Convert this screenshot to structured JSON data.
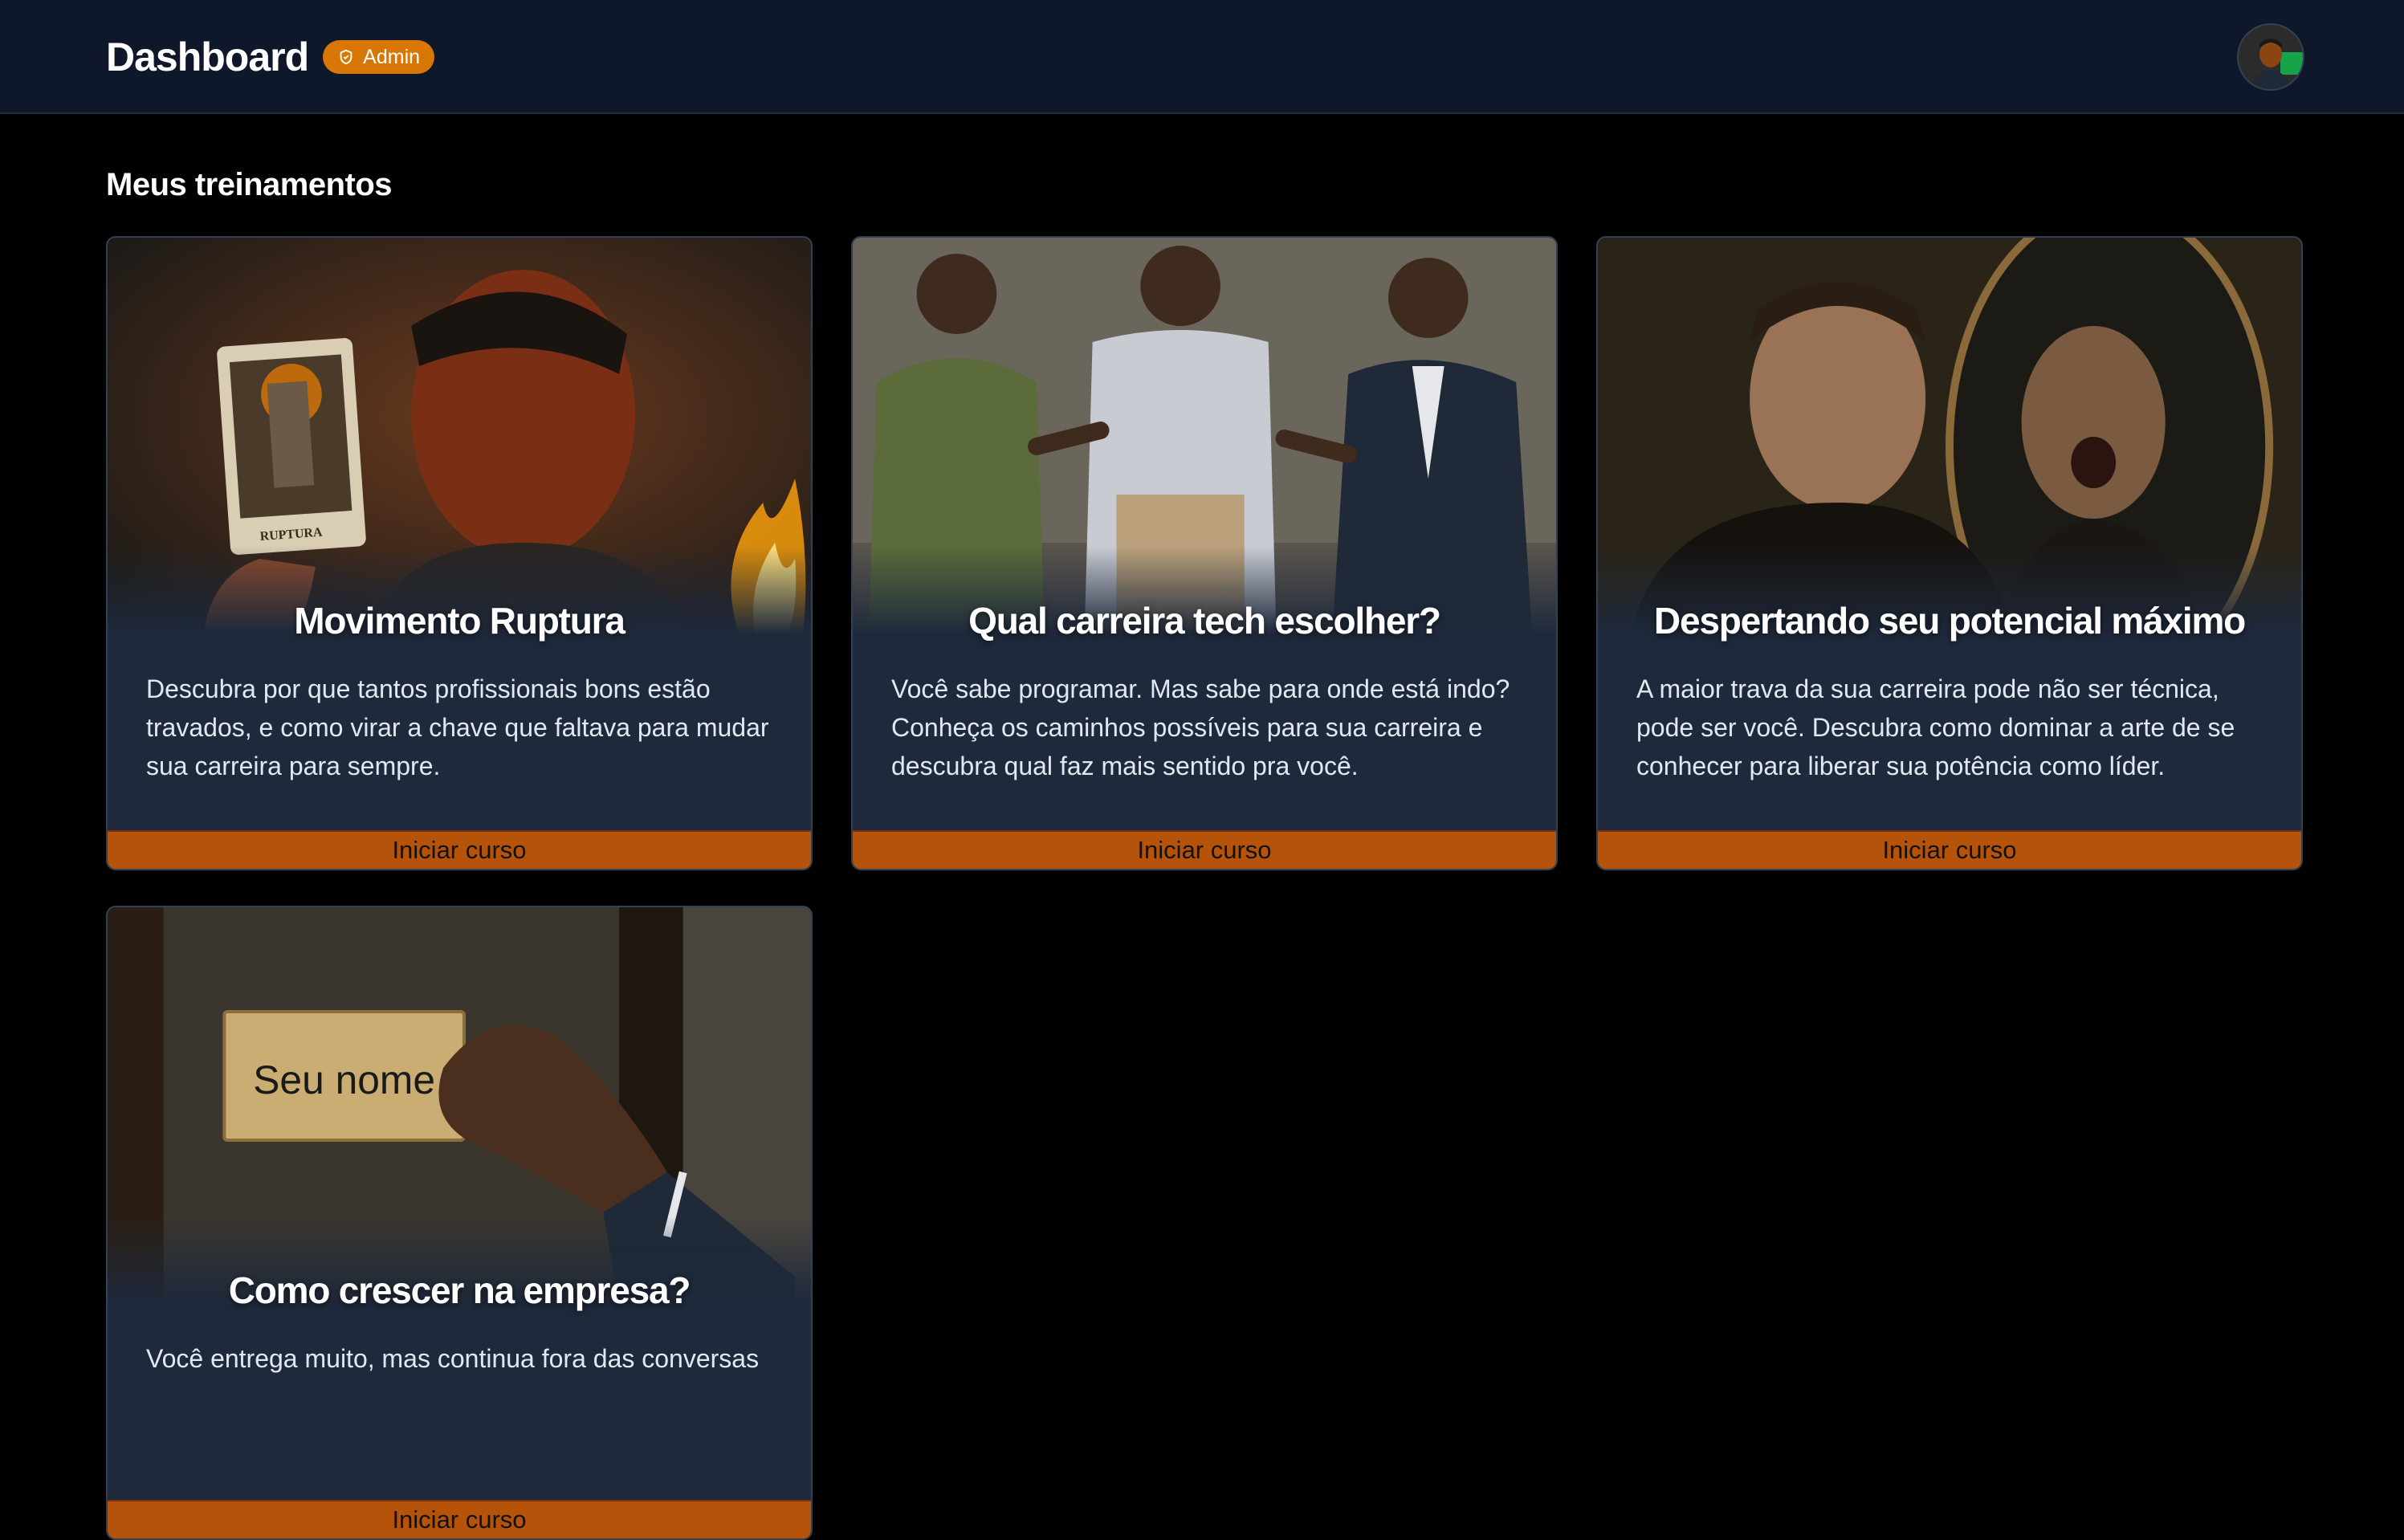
{
  "header": {
    "title": "Dashboard",
    "badge_label": "Admin",
    "badge_icon": "shield-check-icon",
    "avatar": "user-avatar"
  },
  "main": {
    "section_title": "Meus treinamentos",
    "courses": [
      {
        "title": "Movimento Ruptura",
        "description": "Descubra por que tantos profissionais bons estão travados, e como virar a chave que faltava para mudar sua carreira para sempre.",
        "button_label": "Iniciar curso",
        "image_card_text": "RUPTURA"
      },
      {
        "title": "Qual carreira tech escolher?",
        "description": "Você sabe programar. Mas sabe para onde está indo? Conheça os caminhos possíveis para sua carreira e descubra qual faz mais sentido pra você.",
        "button_label": "Iniciar curso"
      },
      {
        "title": "Despertando seu potencial máximo",
        "description": "A maior trava da sua carreira pode não ser técnica, pode ser você. Descubra como dominar a arte de se conhecer para liberar sua potência como líder.",
        "button_label": "Iniciar curso"
      },
      {
        "title": "Como crescer na empresa?",
        "description": "Você entrega muito, mas continua fora das conversas",
        "button_label": "Iniciar curso",
        "image_plate_text": "Seu nome"
      }
    ]
  },
  "colors": {
    "background": "#000000",
    "header_bg": "#0f172a",
    "card_bg": "#1e293b",
    "accent": "#d97706",
    "button_bg": "#b45309"
  }
}
